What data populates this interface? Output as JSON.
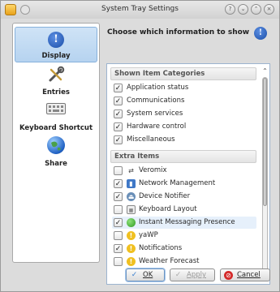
{
  "window": {
    "title": "System Tray Settings",
    "title_buttons": [
      "?",
      "⌄",
      "⌃",
      "×"
    ]
  },
  "sidebar": {
    "items": [
      {
        "label": "Display",
        "icon": "info-icon",
        "active": true
      },
      {
        "label": "Entries",
        "icon": "wrench-screwdriver-icon",
        "active": false
      },
      {
        "label": "Keyboard Shortcut",
        "icon": "keyboard-icon",
        "active": false
      },
      {
        "label": "Share",
        "icon": "globe-icon",
        "active": false
      }
    ]
  },
  "content": {
    "heading": "Choose which information to show",
    "shown_categories": {
      "header": "Shown Item Categories",
      "items": [
        {
          "label": "Application status",
          "checked": true
        },
        {
          "label": "Communications",
          "checked": true
        },
        {
          "label": "System services",
          "checked": true
        },
        {
          "label": "Hardware control",
          "checked": true
        },
        {
          "label": "Miscellaneous",
          "checked": true
        }
      ]
    },
    "extra_items": {
      "header": "Extra Items",
      "items": [
        {
          "label": "Veromix",
          "checked": false,
          "icon": "arrows-icon"
        },
        {
          "label": "Network Management",
          "checked": true,
          "icon": "network-bars-icon"
        },
        {
          "label": "Device Notifier",
          "checked": true,
          "icon": "drive-icon"
        },
        {
          "label": "Keyboard Layout",
          "checked": false,
          "icon": "keyboard-icon"
        },
        {
          "label": "Instant Messaging Presence",
          "checked": true,
          "icon": "green-status-icon"
        },
        {
          "label": "yaWP",
          "checked": false,
          "icon": "info-yellow-icon"
        },
        {
          "label": "Notifications",
          "checked": true,
          "icon": "info-yellow-icon"
        },
        {
          "label": "Weather Forecast",
          "checked": false,
          "icon": "info-yellow-icon"
        }
      ]
    }
  },
  "buttons": {
    "ok": "OK",
    "apply": "Apply",
    "cancel": "Cancel"
  },
  "colors": {
    "accent": "#86b1dc",
    "checked_text": "#222222"
  }
}
